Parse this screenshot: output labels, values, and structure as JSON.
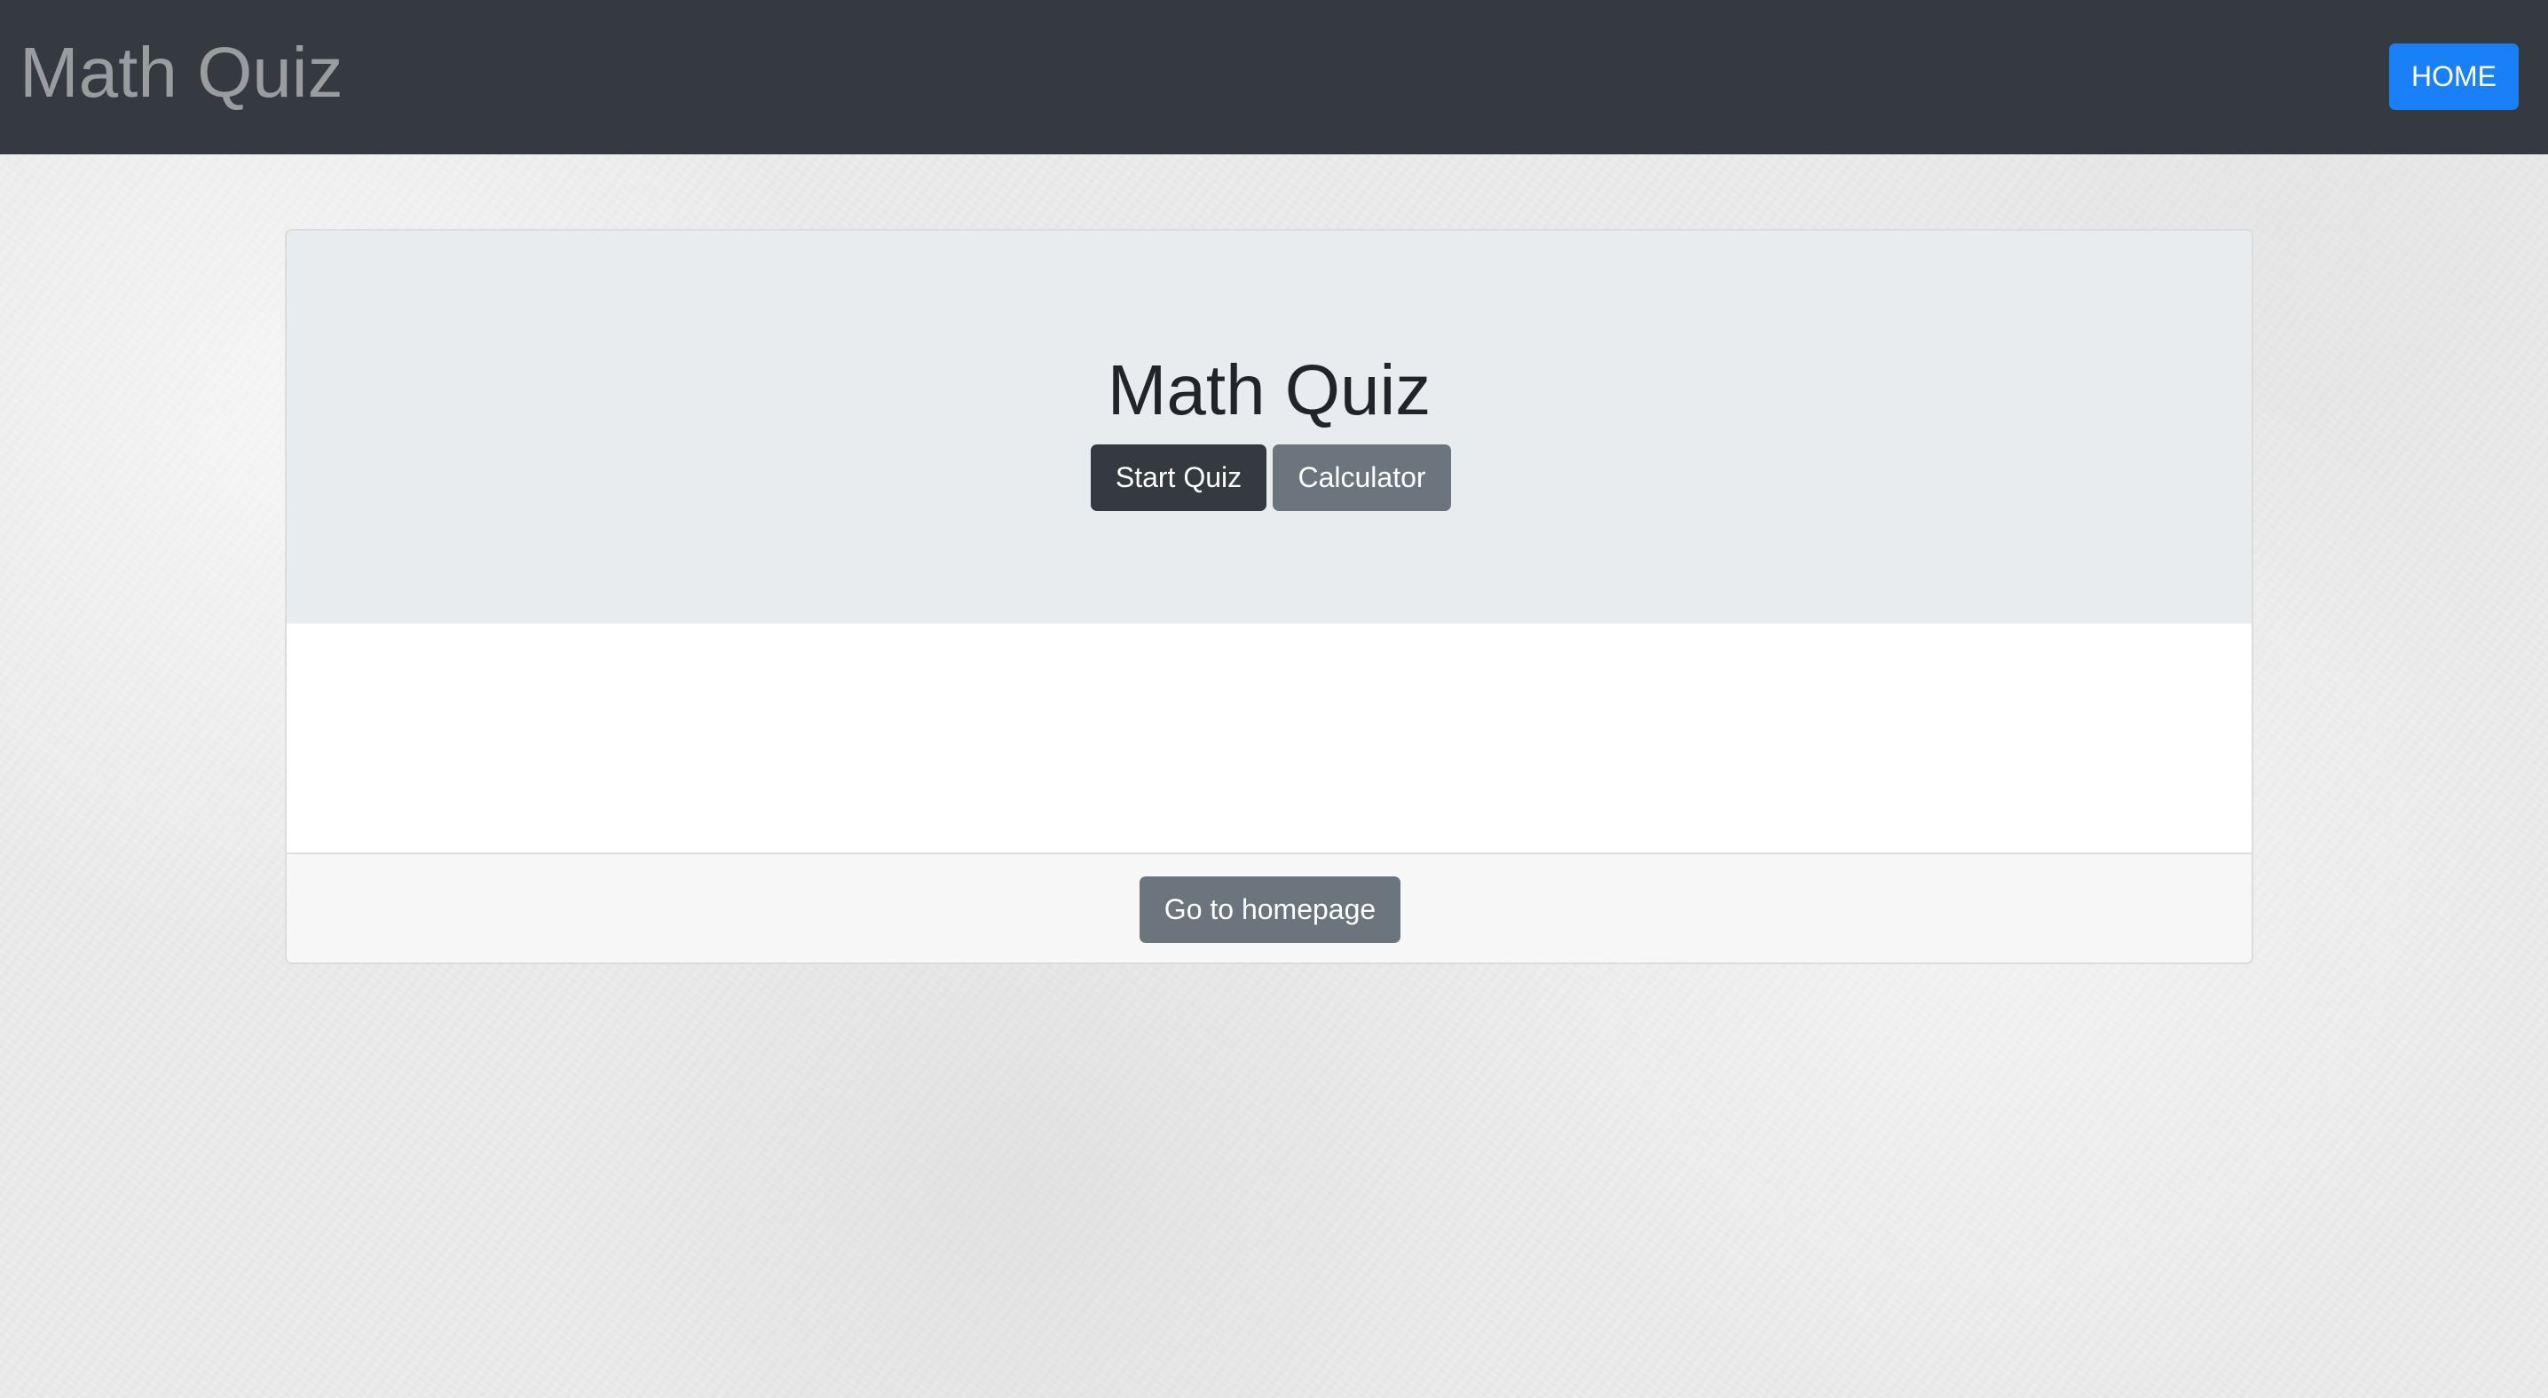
{
  "navbar": {
    "brand": "Math Quiz",
    "home_label": "HOME"
  },
  "jumbotron": {
    "title": "Math Quiz",
    "start_label": "Start Quiz",
    "calculator_label": "Calculator"
  },
  "footer": {
    "homepage_label": "Go to homepage"
  },
  "colors": {
    "navbar_bg": "#343a40",
    "primary": "#1a80f8",
    "dark_button": "#343a40",
    "secondary_button": "#6c757d",
    "jumbotron_bg": "#e9ecef"
  }
}
